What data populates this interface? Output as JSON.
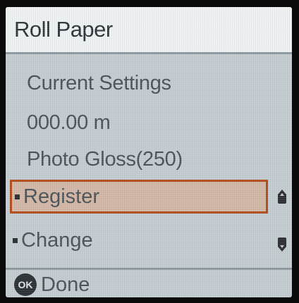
{
  "header": {
    "title": "Roll Paper"
  },
  "info": {
    "heading": "Current Settings",
    "remaining_length": "000.00 m",
    "media_type": "Photo Gloss(250)"
  },
  "menu": {
    "items": [
      {
        "label": "Register",
        "selected": true
      },
      {
        "label": "Change",
        "selected": false
      }
    ]
  },
  "footer": {
    "ok_badge": "OK",
    "action_label": "Done"
  },
  "icons": {
    "scroll_up": "scroll-up-icon",
    "scroll_down": "scroll-down-icon",
    "ok": "ok-button-icon"
  },
  "colors": {
    "selection_border": "#b24a1a",
    "selection_fill": "#d2b7a6",
    "screen_bg": "#c3ccd0"
  }
}
